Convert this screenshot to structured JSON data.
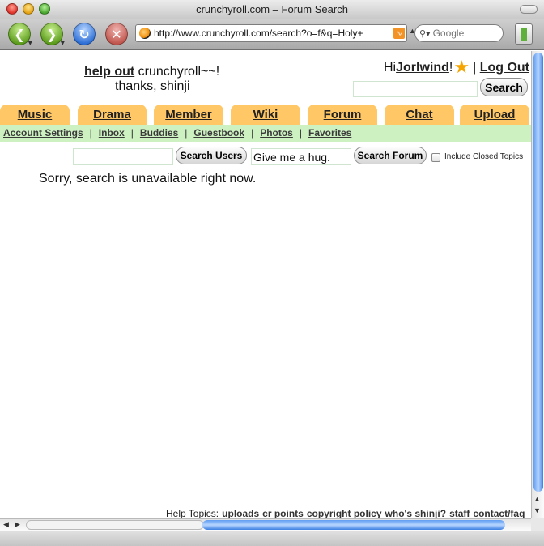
{
  "window": {
    "title": "crunchyroll.com – Forum Search"
  },
  "toolbar": {
    "url": "http://www.crunchyroll.com/search?o=f&q=Holy+",
    "search_placeholder": "Google",
    "back_icon": "left-arrow-icon",
    "forward_icon": "right-arrow-icon",
    "reload_icon": "reload-icon",
    "stop_icon": "stop-icon"
  },
  "header": {
    "help_out_link": "help out",
    "help_out_rest": " crunchyroll~~!",
    "thanks": "thanks, shinji",
    "greeting": "Hi ",
    "username": "Jorlwind",
    "exclaim": "!",
    "separator": "|",
    "logout": "Log Out",
    "search_button": "Search"
  },
  "tabs": [
    "Music",
    "Drama",
    "Member",
    "Wiki",
    "Forum",
    "Chat",
    "Upload"
  ],
  "subnav": {
    "items": [
      "Account Settings",
      "Inbox",
      "Buddies",
      "Guestbook",
      "Photos",
      "Favorites"
    ],
    "separator": "|"
  },
  "search": {
    "users_value": "",
    "users_button": "Search Users",
    "forum_value": "Give me a hug.",
    "forum_button": "Search Forum",
    "include_closed_label": "Include Closed Topics",
    "include_closed_checked": false
  },
  "main": {
    "message": "Sorry, search is unavailable right now."
  },
  "footer": {
    "help_label": "Help Topics:",
    "links": [
      "uploads",
      "cr points",
      "copyright policy",
      "who's shinji?",
      "staff",
      "contact/faq"
    ]
  },
  "colors": {
    "tab": "#ffc765",
    "subnav": "#cdf1c1",
    "star": "#f5a400"
  }
}
